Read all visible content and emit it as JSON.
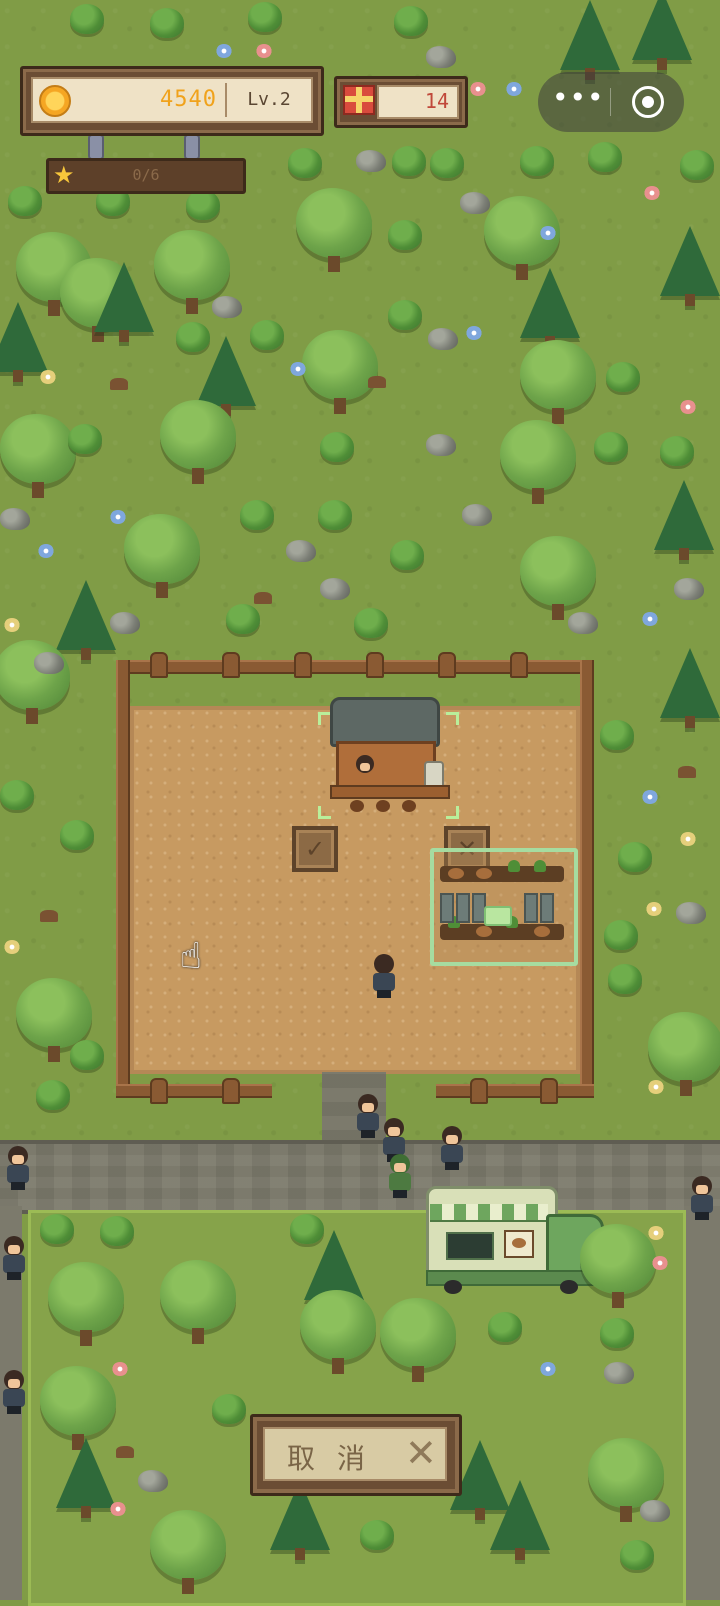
{
  "hud": {
    "coins": "4540",
    "level": "Lv.2",
    "gifts": "14",
    "star_progress_text": "0/6",
    "star_progress_fraction": 0
  },
  "capsule": {
    "more_icon": "more-dots-icon",
    "target_icon": "target-circle-icon"
  },
  "cancel": {
    "label": "取消",
    "icon": "close-x-icon"
  },
  "colors": {
    "coin": "#f0a21b",
    "gift": "#c0483a",
    "grass": "#809c46",
    "soil": "#c79a61"
  }
}
